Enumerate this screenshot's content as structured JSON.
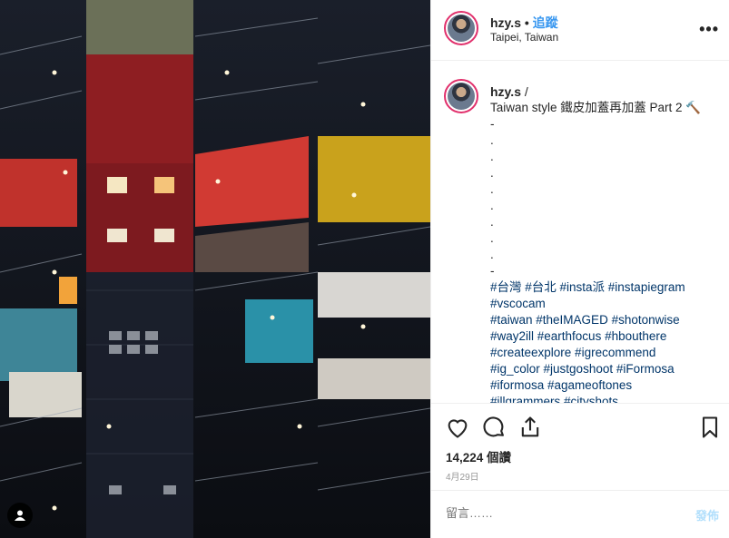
{
  "post": {
    "username": "hzy.s",
    "separator": "•",
    "follow_label": "追蹤",
    "location": "Taipei, Taiwan",
    "more_label": "•••"
  },
  "caption": {
    "username": "hzy.s",
    "username_suffix": " /",
    "lines": [
      "Taiwan style 鐵皮加蓋再加蓋 Part 2 🔨",
      "-",
      ".",
      ".",
      ".",
      ".",
      ".",
      ".",
      ".",
      ".",
      "-"
    ],
    "hashtags": [
      "#台灣 #台北 #insta派 #instapiegram",
      "#vscocam",
      "#taiwan #theIMAGED #shotonwise",
      "#way2ill #earthfocus #hbouthere",
      "#createexplore #igrecommend",
      "#ig_color #justgoshoot #iFormosa",
      "#iformosa #agameoftones",
      "#illgrammers #cityshots"
    ]
  },
  "actions": {
    "like_icon": "heart-icon",
    "comment_icon": "comment-bubble-icon",
    "share_icon": "share-icon",
    "save_icon": "bookmark-icon"
  },
  "stats": {
    "views": "14,224 個讚",
    "date": "4月29日"
  },
  "comment": {
    "placeholder": "留言……",
    "post_label": "發佈"
  },
  "colors": {
    "link_blue": "#3897f0",
    "hashtag_blue": "#003569",
    "story_ring": "#e1306c",
    "post_disabled": "#b2dffc"
  }
}
